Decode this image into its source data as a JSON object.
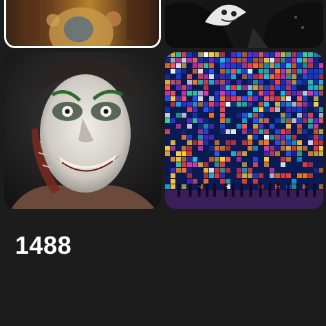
{
  "gallery": {
    "tiles": [
      {
        "name": "ornate-portrait-image",
        "selected": true
      },
      {
        "name": "masked-figure-image",
        "selected": false
      },
      {
        "name": "clown-face-image",
        "selected": false
      },
      {
        "name": "pixel-city-image",
        "selected": false
      }
    ],
    "count_label": "1488"
  }
}
